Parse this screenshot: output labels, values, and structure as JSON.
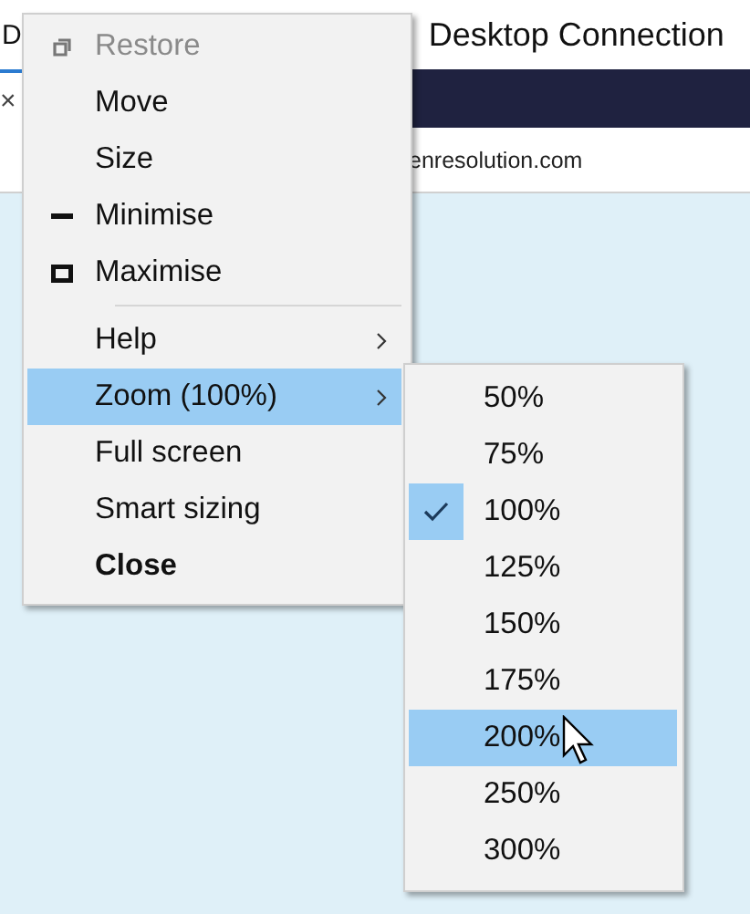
{
  "window": {
    "title_start": "D",
    "title_end": "Desktop Connection"
  },
  "tab": {
    "close_glyph": "×"
  },
  "address_bar": {
    "value": "enresolution.com"
  },
  "system_menu": {
    "items": [
      {
        "kind": "restore",
        "label": "Restore",
        "disabled": true,
        "highlighted": false,
        "submenu": false,
        "default": false
      },
      {
        "kind": "item",
        "label": "Move",
        "disabled": false,
        "highlighted": false,
        "submenu": false,
        "default": false
      },
      {
        "kind": "item",
        "label": "Size",
        "disabled": false,
        "highlighted": false,
        "submenu": false,
        "default": false
      },
      {
        "kind": "minimise",
        "label": "Minimise",
        "disabled": false,
        "highlighted": false,
        "submenu": false,
        "default": false
      },
      {
        "kind": "maximise",
        "label": "Maximise",
        "disabled": false,
        "highlighted": false,
        "submenu": false,
        "default": false
      },
      {
        "kind": "separator"
      },
      {
        "kind": "item",
        "label": "Help",
        "disabled": false,
        "highlighted": false,
        "submenu": true,
        "default": false
      },
      {
        "kind": "item",
        "label": "Zoom (100%)",
        "disabled": false,
        "highlighted": true,
        "submenu": true,
        "default": false
      },
      {
        "kind": "item",
        "label": "Full screen",
        "disabled": false,
        "highlighted": false,
        "submenu": false,
        "default": false
      },
      {
        "kind": "item",
        "label": "Smart sizing",
        "disabled": false,
        "highlighted": false,
        "submenu": false,
        "default": false
      },
      {
        "kind": "item",
        "label": "Close",
        "disabled": false,
        "highlighted": false,
        "submenu": false,
        "default": true
      }
    ]
  },
  "zoom_submenu": {
    "items": [
      {
        "label": "50%",
        "checked": false,
        "highlighted": false
      },
      {
        "label": "75%",
        "checked": false,
        "highlighted": false
      },
      {
        "label": "100%",
        "checked": true,
        "highlighted": false
      },
      {
        "label": "125%",
        "checked": false,
        "highlighted": false
      },
      {
        "label": "150%",
        "checked": false,
        "highlighted": false
      },
      {
        "label": "175%",
        "checked": false,
        "highlighted": false
      },
      {
        "label": "200%",
        "checked": false,
        "highlighted": true
      },
      {
        "label": "250%",
        "checked": false,
        "highlighted": false
      },
      {
        "label": "300%",
        "checked": false,
        "highlighted": false
      }
    ]
  }
}
